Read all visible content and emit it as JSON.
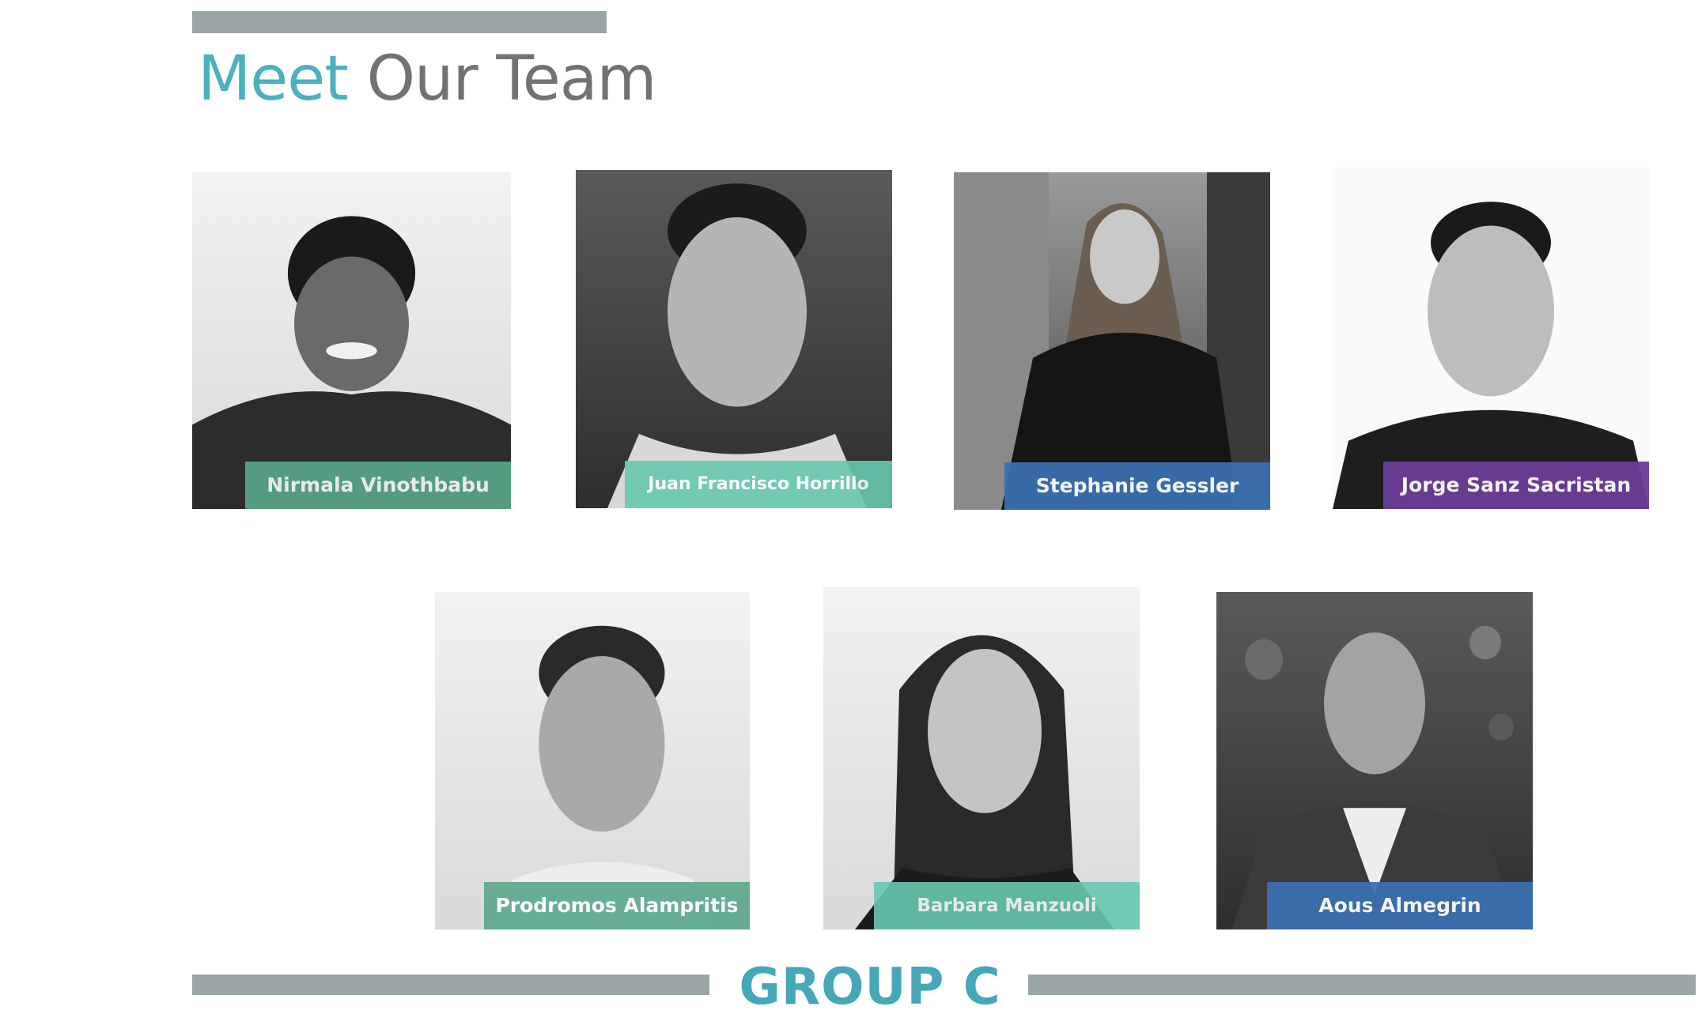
{
  "heading": {
    "accent_word": "Meet",
    "rest_text": "Our Team"
  },
  "colors": {
    "accent": "#4cb1bf",
    "heading_gray": "#707273",
    "divider_gray": "#9aa5a7",
    "green_tag": "#5aa88b",
    "teal_tag": "#67c8b1",
    "blue_tag": "#3a6faf",
    "purple_tag": "#6a3d97"
  },
  "team": [
    {
      "name": "Nirmala Vinothbabu",
      "tag_color": "#5aa88b"
    },
    {
      "name": "Juan Francisco Horrillo",
      "tag_color": "#67c8b1"
    },
    {
      "name": "Stephanie Gessler",
      "tag_color": "#3a6faf"
    },
    {
      "name": "Jorge Sanz Sacristan",
      "tag_color": "#6a3d97"
    },
    {
      "name": "Prodromos Alampritis",
      "tag_color": "#5aa88b"
    },
    {
      "name": "Barbara Manzuoli",
      "tag_color": "#67c8b1"
    },
    {
      "name": "Aous Almegrin",
      "tag_color": "#3a6faf"
    }
  ],
  "group_label": "GROUP C"
}
